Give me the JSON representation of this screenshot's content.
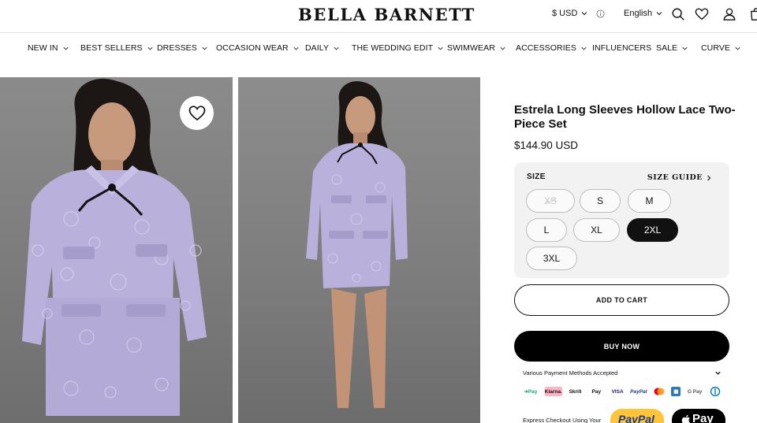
{
  "brand": {
    "name": "BELLA BARNETT"
  },
  "header": {
    "currency": "$ USD",
    "language": "English",
    "icons": [
      "search-icon",
      "heart-icon",
      "user-icon",
      "bag-icon"
    ]
  },
  "nav": {
    "items": [
      {
        "label": "NEW IN",
        "has_dropdown": true
      },
      {
        "label": "BEST SELLERS",
        "has_dropdown": true
      },
      {
        "label": "DRESSES",
        "has_dropdown": true
      },
      {
        "label": "OCCASION WEAR",
        "has_dropdown": true
      },
      {
        "label": "DAILY",
        "has_dropdown": true
      },
      {
        "label": "THE WEDDING EDIT",
        "has_dropdown": true
      },
      {
        "label": "SWIMWEAR",
        "has_dropdown": true
      },
      {
        "label": "ACCESSORIES",
        "has_dropdown": true
      },
      {
        "label": "INFLUENCERS",
        "has_dropdown": false
      },
      {
        "label": "SALE",
        "has_dropdown": true
      },
      {
        "label": "CURVE",
        "has_dropdown": true
      }
    ]
  },
  "product": {
    "title": "Estrela Long Sleeves Hollow Lace Two-Piece Set",
    "price": "$144.90 USD",
    "size_label": "SIZE",
    "size_guide": "SIZE GUIDE",
    "sizes": [
      {
        "label": "XS",
        "state": "unavailable"
      },
      {
        "label": "S",
        "state": "available"
      },
      {
        "label": "M",
        "state": "available"
      },
      {
        "label": "L",
        "state": "available"
      },
      {
        "label": "XL",
        "state": "available"
      },
      {
        "label": "2XL",
        "state": "selected"
      },
      {
        "label": "3XL",
        "state": "available"
      }
    ],
    "add_to_cart": "ADD TO CART",
    "buy_now": "BUY NOW",
    "payment_methods_label": "Various Payment Methods Accepted",
    "payment_icons": [
      "Afterpay",
      "Klarna.",
      "Skrill",
      "Apple Pay",
      "VISA",
      "PayPal",
      "Mastercard",
      "Amex",
      "G Pay",
      "Diners"
    ],
    "express_checkout": "Express Checkout Using Your",
    "paypal_label": "PayPal",
    "applepay_label": "Pay"
  },
  "colors": {
    "garment": "#b9b1dc",
    "background": "#7f7f7f",
    "accent": "#111111"
  }
}
